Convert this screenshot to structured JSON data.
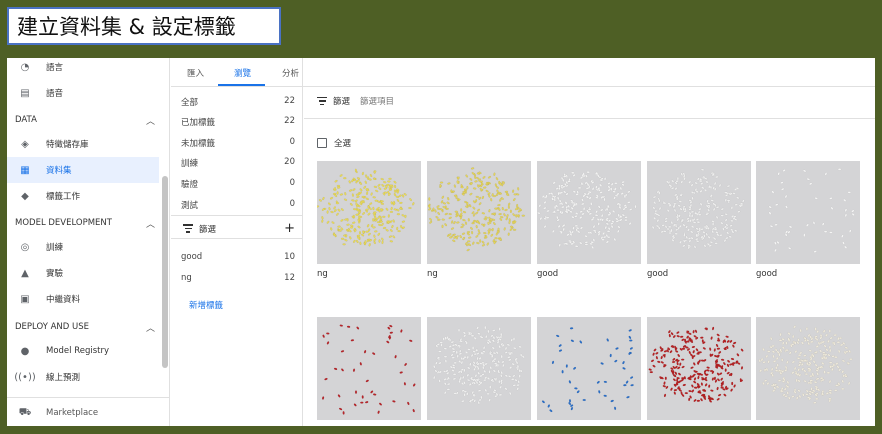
{
  "slide_title": "建立資料集 & 設定標籤",
  "sidebar": {
    "items_top": [
      {
        "label": "語言",
        "icon": "language-icon"
      },
      {
        "label": "語音",
        "icon": "speech-icon"
      }
    ],
    "section_data": "DATA",
    "items_data": [
      {
        "label": "特徵儲存庫",
        "icon": "feature-store-icon"
      },
      {
        "label": "資料集",
        "icon": "dataset-icon"
      },
      {
        "label": "標籤工作",
        "icon": "label-tag-icon"
      }
    ],
    "section_model_dev": "MODEL DEVELOPMENT",
    "items_model_dev": [
      {
        "label": "訓練",
        "icon": "training-icon"
      },
      {
        "label": "實驗",
        "icon": "experiment-flask-icon"
      },
      {
        "label": "中繼資料",
        "icon": "metadata-icon"
      }
    ],
    "section_deploy": "DEPLOY AND USE",
    "items_deploy": [
      {
        "label": "Model Registry",
        "icon": "lightbulb-icon"
      },
      {
        "label": "線上預測",
        "icon": "broadcast-icon"
      }
    ],
    "marketplace": "Marketplace"
  },
  "tabs": [
    "匯入",
    "瀏覽",
    "分析"
  ],
  "counts": [
    {
      "label": "全部",
      "value": "22"
    },
    {
      "label": "已加標籤",
      "value": "22"
    },
    {
      "label": "未加標籤",
      "value": "0"
    },
    {
      "label": "訓練",
      "value": "20"
    },
    {
      "label": "驗證",
      "value": "0"
    },
    {
      "label": "測試",
      "value": "0"
    }
  ],
  "mid_filter": "篩選",
  "labels": [
    {
      "label": "good",
      "value": "10"
    },
    {
      "label": "ng",
      "value": "12"
    }
  ],
  "add_label": "新增標籤",
  "filter_bar": {
    "filter": "篩選",
    "filter_items": "篩選項目"
  },
  "select_all": "全選",
  "images": [
    {
      "caption": "ng",
      "color": "#e8d95a"
    },
    {
      "caption": "ng",
      "color": "#e3d35c"
    },
    {
      "caption": "good",
      "color": "#f2f2f2"
    },
    {
      "caption": "good",
      "color": "#efefef"
    },
    {
      "caption": "good",
      "color": "#f5f5f5"
    },
    {
      "caption": "",
      "color": "#b8252a"
    },
    {
      "caption": "",
      "color": "#f0f0f0"
    },
    {
      "caption": "",
      "color": "#2a6fc9"
    },
    {
      "caption": "",
      "color": "#b82224"
    },
    {
      "caption": "",
      "color": "#efeadc"
    }
  ]
}
